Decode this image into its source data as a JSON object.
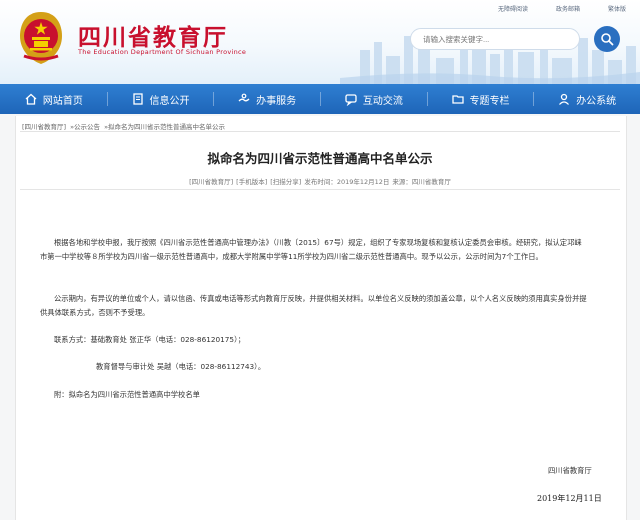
{
  "header": {
    "top_links": [
      "无障碍阅读",
      "政务邮箱",
      "繁体版"
    ],
    "site_title": "四川省教育厅",
    "site_subtitle": "The Education Department Of Sichuan Province",
    "search_placeholder": "请输入搜索关键字..."
  },
  "nav": {
    "items": [
      {
        "label": "网站首页",
        "icon": "home-icon"
      },
      {
        "label": "信息公开",
        "icon": "document-icon"
      },
      {
        "label": "办事服务",
        "icon": "service-icon"
      },
      {
        "label": "互动交流",
        "icon": "chat-icon"
      },
      {
        "label": "专题专栏",
        "icon": "folder-icon"
      },
      {
        "label": "办公系统",
        "icon": "user-icon"
      }
    ]
  },
  "breadcrumb": [
    "[四川省教育厅]",
    "»公示公告",
    "»拟命名为四川省示范性普通高中名单公示"
  ],
  "article": {
    "title": "拟命名为四川省示范性普通高中名单公示",
    "meta": [
      "[四川省教育厅]",
      "[手机版本]",
      "[扫描分享]",
      "发布时间：2019年12月12日",
      "来源：四川省教育厅"
    ],
    "para1": "根据各地和学校申报，我厅按照《四川省示范性普通高中管理办法》（川教〔2015〕67号）规定，组织了专家现场复核和复核认定委员会审核。经研究，拟认定邛崃市第一中学校等８所学校为四川省一级示范性普通高中，成都大学附属中学等11所学校为四川省二级示范性普通高中。现予以公示，公示时间为7个工作日。",
    "para2": "公示期内，有异议的单位或个人，请以信函、传真或电话等形式向教育厅反映，并提供相关材料。以单位名义反映的须加盖公章，以个人名义反映的须用真实身份并提供具体联系方式，否则不予受理。",
    "contact1": "联系方式：基础教育处 张正华（电话：028-86120175）；",
    "contact2": "教育督导与审计处 吴越（电话：028-86112743）。",
    "attachment": "附：拟命名为四川省示范性普通高中学校名单",
    "signature": "四川省教育厅",
    "date": "2019年12月11日"
  },
  "colors": {
    "brand_red": "#c8102e",
    "nav_blue": "#1e65b8"
  }
}
